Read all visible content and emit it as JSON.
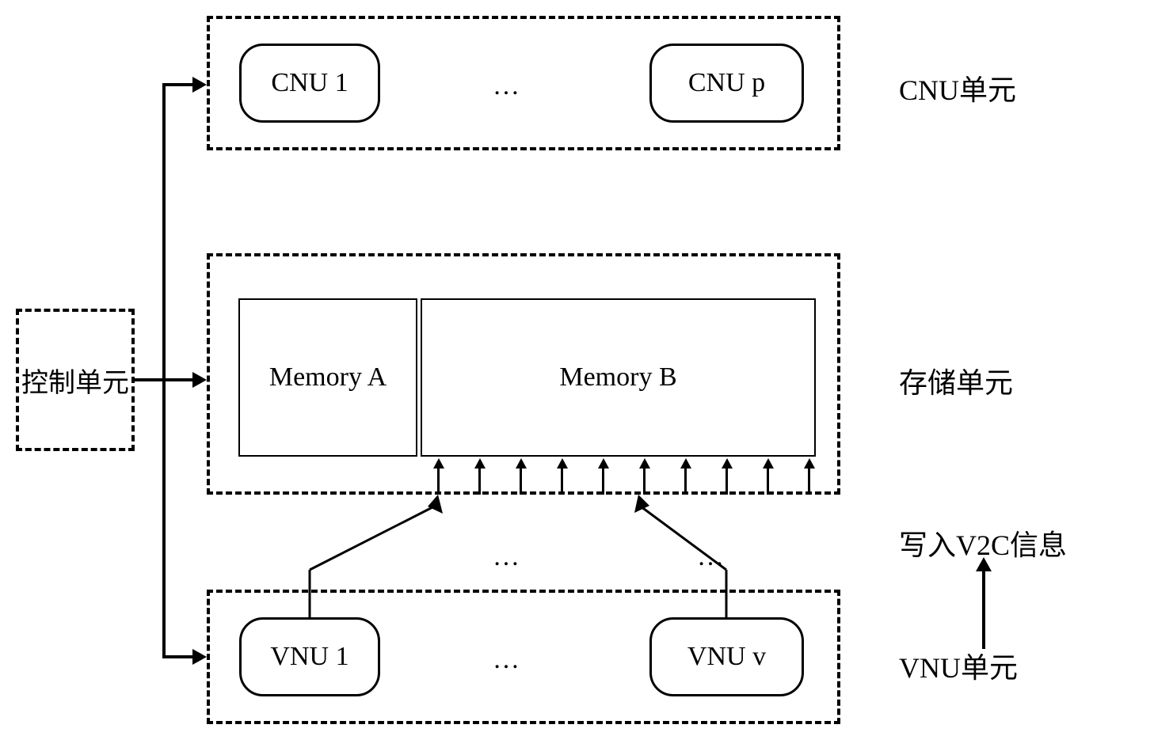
{
  "control_unit": {
    "label": "控制单元"
  },
  "cnu_block": {
    "label": "CNU单元",
    "node1": "CNU 1",
    "node_last": "CNU  p",
    "ellipsis": "…"
  },
  "memory_block": {
    "label": "存储单元",
    "mem_a": "Memory A",
    "mem_b": "Memory B"
  },
  "vnu_block": {
    "label": "VNU单元",
    "node1": "VNU 1",
    "node_last": "VNU  v",
    "ellipsis": "…"
  },
  "write_label": "写入V2C信息",
  "ellipsis_between": "…"
}
